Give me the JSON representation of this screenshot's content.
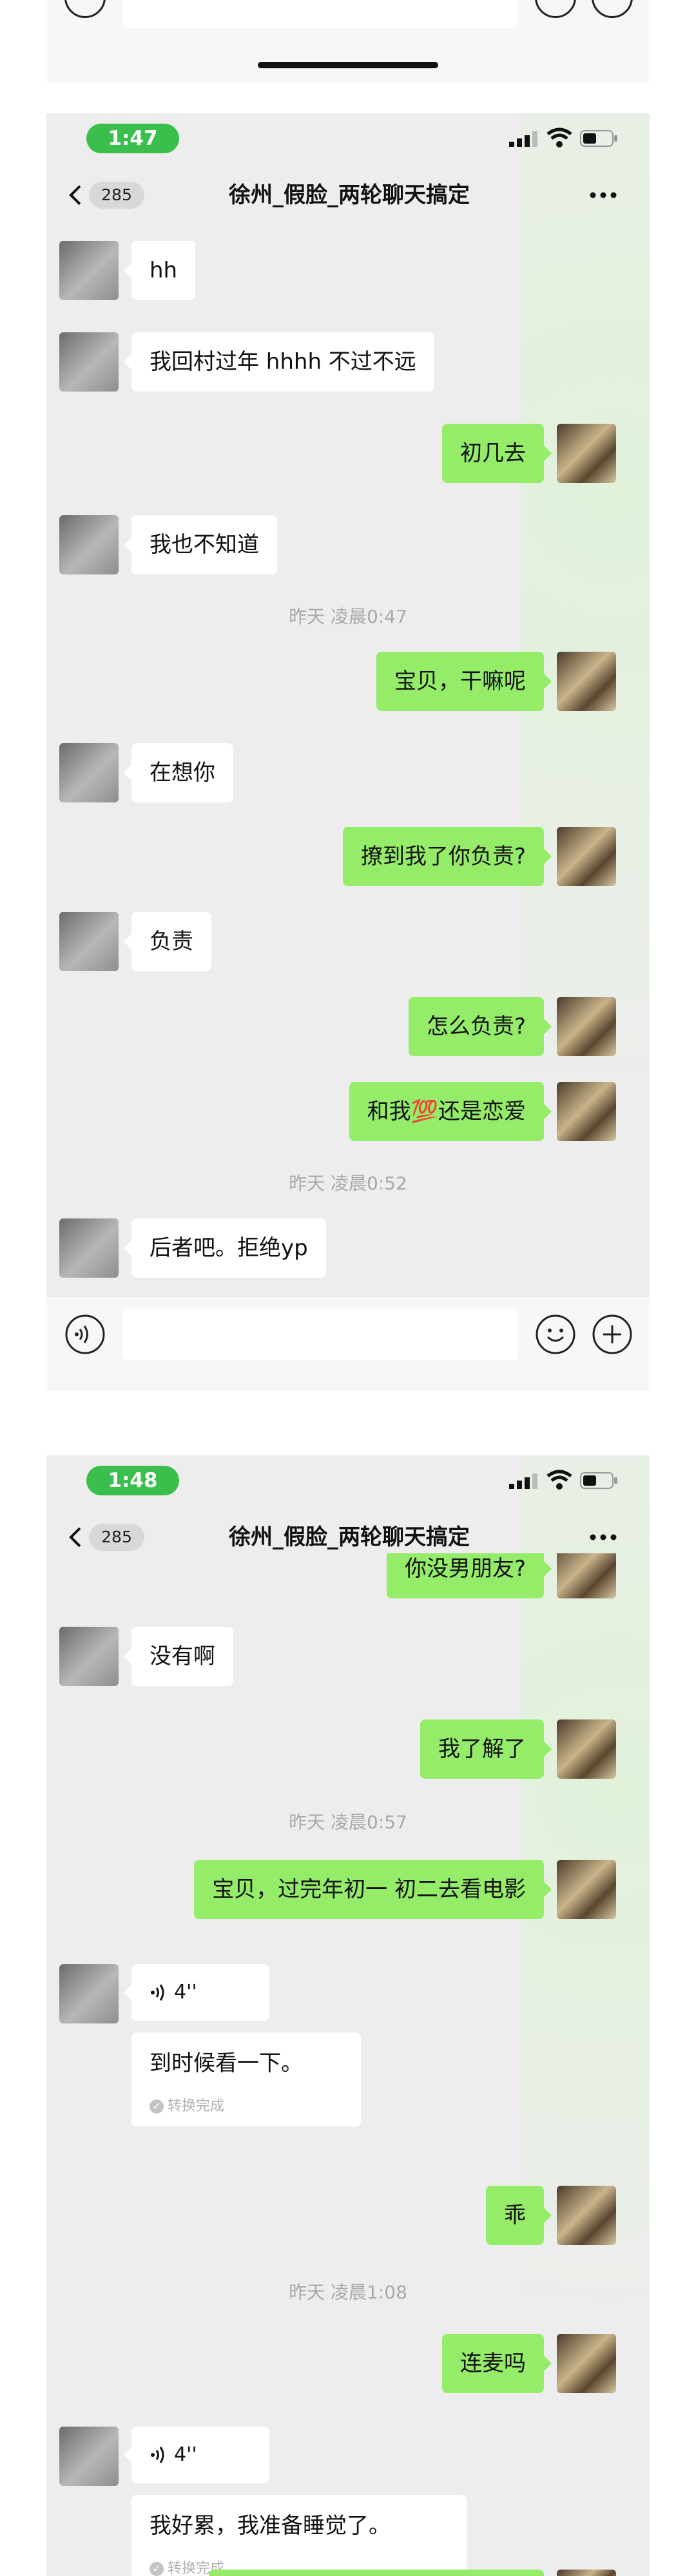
{
  "colors": {
    "accent_green": "#95ec69",
    "time_pill": "#3bbf4c",
    "chat_bg": "#ededed"
  },
  "frame1": {
    "time": "1:47",
    "back_count": "285",
    "title": "徐州_假脸_两轮聊天搞定",
    "messages": {
      "m1": "hh",
      "m2": "我回村过年 hhhh 不过不远",
      "m3": "初几去",
      "m4": "我也不知道",
      "ts1": "昨天 凌晨0:47",
      "m5": "宝贝，干嘛呢",
      "m6": "在想你",
      "m7": "撩到我了你负责?",
      "m8": "负责",
      "m9": "怎么负责?",
      "m10a": "和我",
      "m10_emoji": "💯",
      "m10b": "还是恋爱",
      "ts2": "昨天 凌晨0:52",
      "m11": "后者吧。拒绝yp"
    }
  },
  "frame2": {
    "time": "1:48",
    "back_count": "285",
    "title": "徐州_假脸_两轮聊天搞定",
    "messages": {
      "m1": "你没男朋友?",
      "m2": "没有啊",
      "m3": "我了解了",
      "ts1": "昨天 凌晨0:57",
      "m4": "宝贝，过完年初一 初二去看电影",
      "voice1_dur": "4''",
      "voice1_text": "到时候看一下。",
      "conv_status": "转换完成",
      "m5": "乖",
      "ts2": "昨天 凌晨1:08",
      "m6": "连麦吗",
      "voice2_dur": "4''",
      "voice2_text": "我好累，我准备睡觉了。"
    }
  },
  "icons": {
    "voice": "voice-input-icon",
    "emoji": "emoji-icon",
    "add": "plus-icon",
    "back": "chevron-left-icon",
    "more": "more-dots-icon"
  }
}
